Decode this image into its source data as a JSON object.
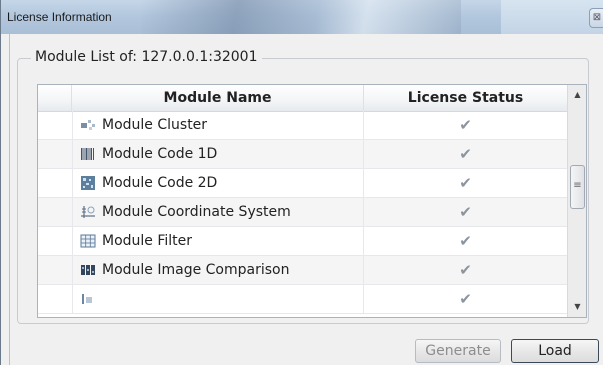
{
  "window": {
    "title": "License Information",
    "close_label": "⊠"
  },
  "group": {
    "label": "Module List of: 127.0.0.1:32001"
  },
  "table": {
    "columns": [
      "Module Name",
      "License Status"
    ],
    "rows": [
      {
        "name": "Module Cluster",
        "icon": "cluster-icon",
        "status": "licensed"
      },
      {
        "name": "Module Code 1D",
        "icon": "barcode-icon",
        "status": "licensed"
      },
      {
        "name": "Module Code 2D",
        "icon": "qrcode-icon",
        "status": "licensed"
      },
      {
        "name": "Module Coordinate System",
        "icon": "coordinate-icon",
        "status": "licensed"
      },
      {
        "name": "Module Filter",
        "icon": "filter-grid-icon",
        "status": "licensed"
      },
      {
        "name": "Module Image Comparison",
        "icon": "image-comparison-icon",
        "status": "licensed"
      }
    ],
    "check_glyph": "✔",
    "sort_glyph": "ˆ"
  },
  "scrollbar": {
    "up": "▲",
    "down": "▼",
    "grip": "≡"
  },
  "buttons": {
    "generate": "Generate",
    "load": "Load"
  },
  "colors": {
    "title_bar": "#b3c8de",
    "check": "#8c959e",
    "disabled_text": "#8d8d8d"
  }
}
